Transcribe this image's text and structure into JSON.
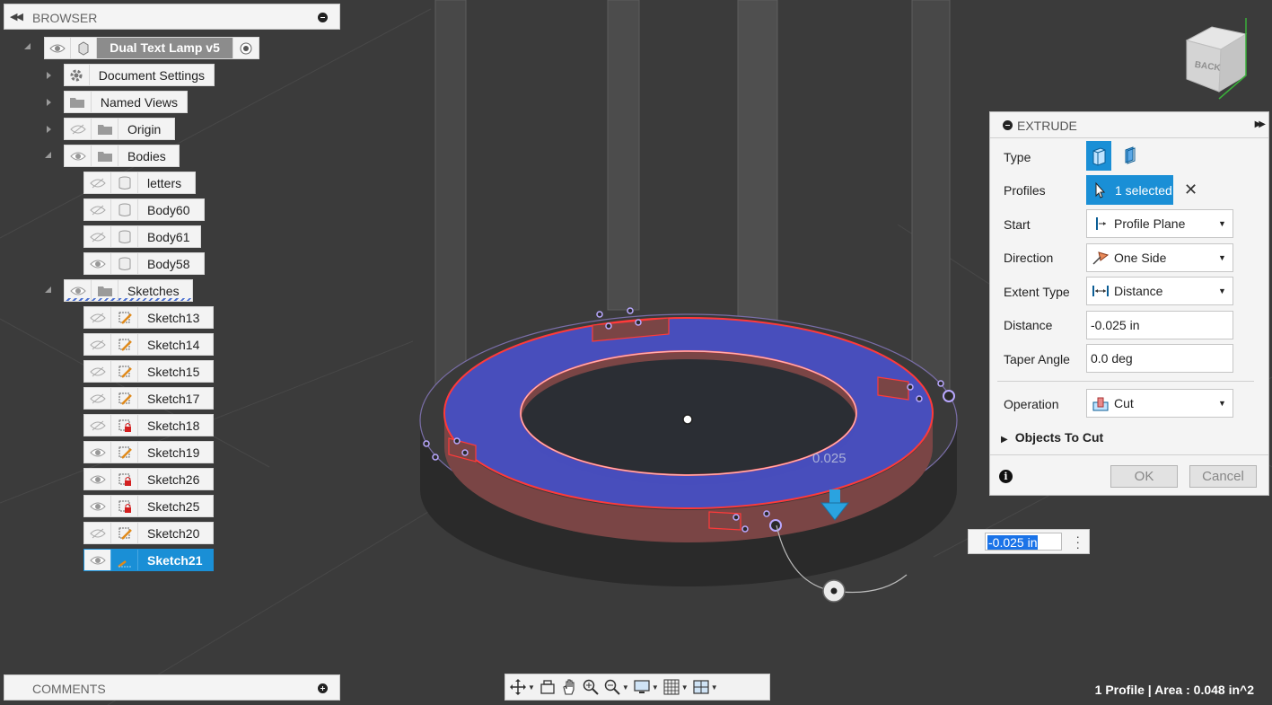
{
  "browser": {
    "title": "BROWSER",
    "root": {
      "label": "Dual Text Lamp v5"
    },
    "items": [
      {
        "label": "Document Settings"
      },
      {
        "label": "Named Views"
      },
      {
        "label": "Origin"
      },
      {
        "label": "Bodies"
      },
      {
        "label": "letters"
      },
      {
        "label": "Body60"
      },
      {
        "label": "Body61"
      },
      {
        "label": "Body58"
      },
      {
        "label": "Sketches"
      },
      {
        "label": "Sketch13"
      },
      {
        "label": "Sketch14"
      },
      {
        "label": "Sketch15"
      },
      {
        "label": "Sketch17"
      },
      {
        "label": "Sketch18"
      },
      {
        "label": "Sketch19"
      },
      {
        "label": "Sketch26"
      },
      {
        "label": "Sketch25"
      },
      {
        "label": "Sketch20"
      },
      {
        "label": "Sketch21"
      }
    ]
  },
  "comments": {
    "title": "COMMENTS"
  },
  "viewcube": {
    "face_label": "BACK"
  },
  "viewport": {
    "dimension_label": "0.025"
  },
  "extrude": {
    "title": "EXTRUDE",
    "rows": {
      "type_label": "Type",
      "profiles_label": "Profiles",
      "profiles_value": "1 selected",
      "start_label": "Start",
      "start_value": "Profile Plane",
      "direction_label": "Direction",
      "direction_value": "One Side",
      "extent_label": "Extent Type",
      "extent_value": "Distance",
      "distance_label": "Distance",
      "distance_value": "-0.025 in",
      "taper_label": "Taper Angle",
      "taper_value": "0.0 deg",
      "operation_label": "Operation",
      "operation_value": "Cut",
      "objects_label": "Objects To Cut"
    },
    "ok_label": "OK",
    "cancel_label": "Cancel"
  },
  "inline_input": {
    "value": "-0.025 in"
  },
  "status": {
    "text": "1 Profile | Area : 0.048 in^2"
  },
  "colors": {
    "accent": "#1a8fd6",
    "selection_face": "#4a50c8",
    "edge_highlight": "#ff3030",
    "background": "#3b3b3b"
  }
}
